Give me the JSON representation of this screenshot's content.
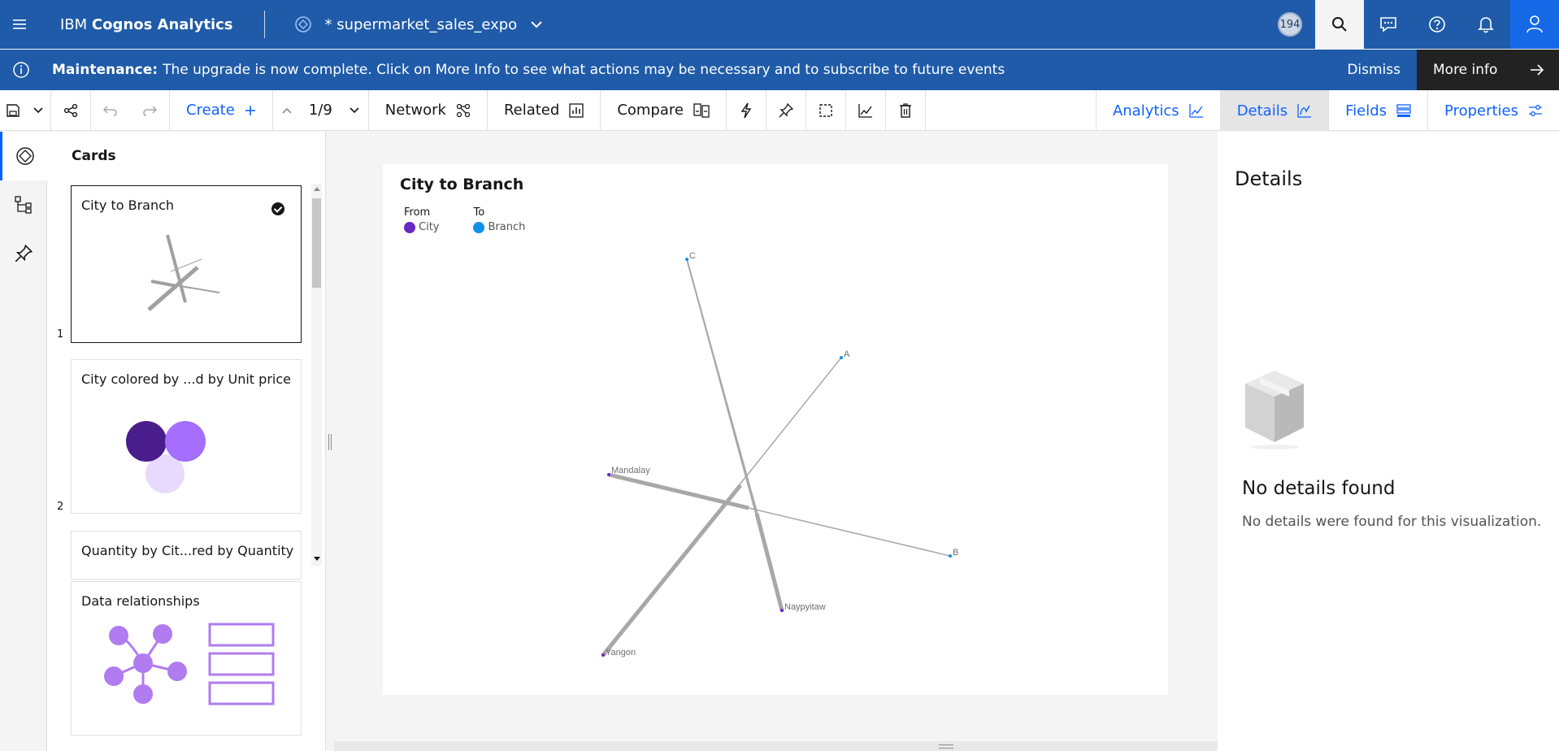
{
  "topbar": {
    "brand_prefix": "IBM ",
    "brand_product": "Cognos Analytics",
    "document_title": "* supermarket_sales_expo",
    "badge": "194"
  },
  "banner": {
    "label": "Maintenance:",
    "message": "The upgrade is now complete. Click on More Info to see what actions may be necessary and to subscribe to future events",
    "dismiss": "Dismiss",
    "more_info": "More info"
  },
  "toolbar": {
    "create": "Create",
    "pager": "1/9",
    "network": "Network",
    "related": "Related",
    "compare": "Compare",
    "analytics": "Analytics",
    "details": "Details",
    "fields": "Fields",
    "properties": "Properties"
  },
  "cards_panel": {
    "title": "Cards",
    "cards": [
      {
        "title": "City to Branch",
        "number": "1"
      },
      {
        "title": "City colored by ...d by Unit price",
        "number": "2"
      },
      {
        "title": "Quantity by Cit...red by Quantity",
        "number": ""
      },
      {
        "title": "Data relationships",
        "number": ""
      }
    ]
  },
  "viz": {
    "title": "City to Branch",
    "legend": {
      "from_label": "From",
      "from_item": "City",
      "from_color": "#6929c4",
      "to_label": "To",
      "to_item": "Branch",
      "to_color": "#1192e8"
    },
    "nodes": [
      "C",
      "A",
      "Mandalay",
      "B",
      "Naypyitaw",
      "Yangon"
    ]
  },
  "details_panel": {
    "title": "Details",
    "empty_title": "No details found",
    "empty_message": "No details were found for this visualization."
  }
}
